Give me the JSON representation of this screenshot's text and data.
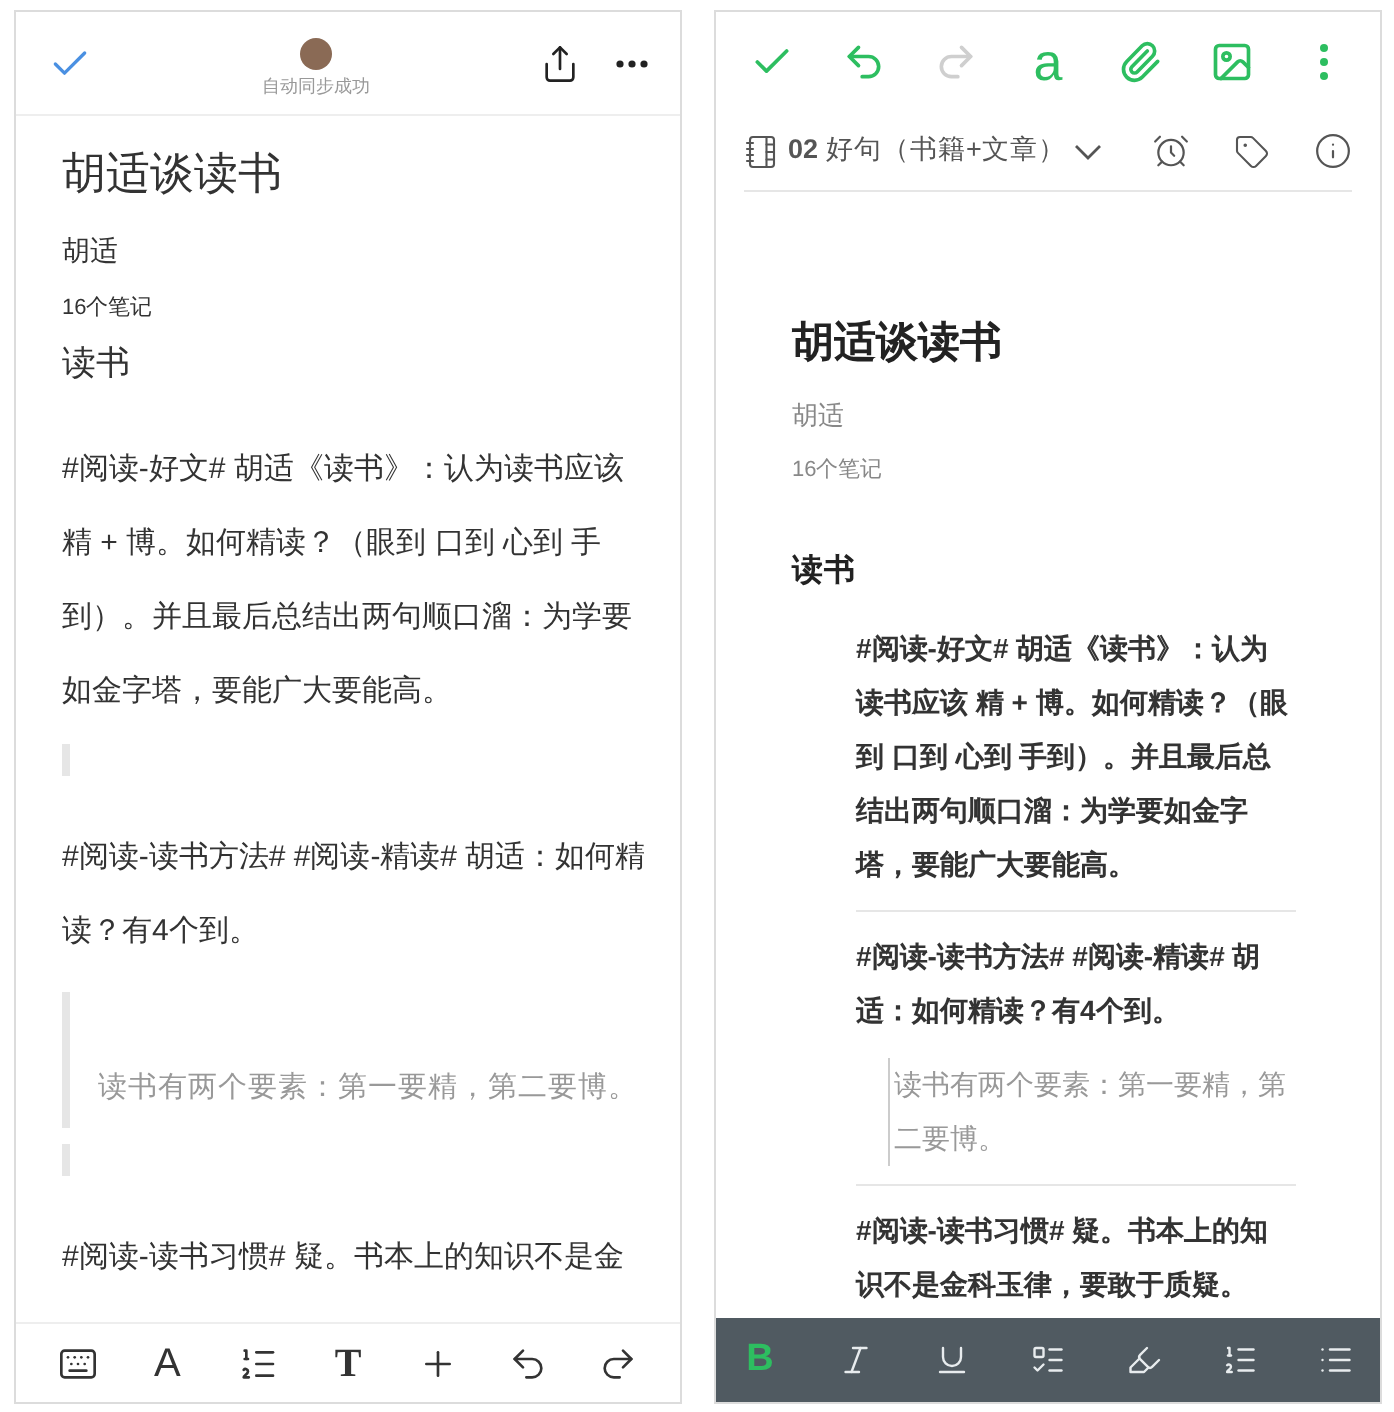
{
  "left_editor": {
    "header": {
      "sync_status": "自动同步成功"
    },
    "title": "胡适谈读书",
    "author": "胡适",
    "note_count": "16个笔记",
    "heading": "读书",
    "blocks": [
      {
        "kind": "paragraph",
        "text": "#阅读-好文# 胡适《读书》：认为读书应该精 + 博。如何精读？（眼到 口到 心到 手到）。并且最后总结出两句顺口溜：为学要如金字塔，要能广大要能高。"
      },
      {
        "kind": "empty_quote"
      },
      {
        "kind": "paragraph",
        "text": "#阅读-读书方法# #阅读-精读# 胡适：如何精读？有4个到。"
      },
      {
        "kind": "quote",
        "text": "读书有两个要素：第一要精，第二要博。"
      },
      {
        "kind": "empty_quote"
      },
      {
        "kind": "paragraph",
        "text": "#阅读-读书习惯# 疑。书本上的知识不是金"
      }
    ],
    "toolbar": [
      {
        "kind": "keyboard"
      },
      {
        "kind": "glyph",
        "label": "A"
      },
      {
        "kind": "ordered_list"
      },
      {
        "kind": "serif_glyph",
        "label": "T"
      },
      {
        "kind": "plus"
      },
      {
        "kind": "undo"
      },
      {
        "kind": "redo"
      }
    ]
  },
  "right_editor": {
    "toolbar": [
      {
        "kind": "check",
        "disabled": false
      },
      {
        "kind": "undo",
        "disabled": false
      },
      {
        "kind": "redo",
        "disabled": true
      },
      {
        "kind": "glyph",
        "label": "a",
        "disabled": false
      },
      {
        "kind": "attach",
        "disabled": false
      },
      {
        "kind": "image",
        "disabled": false
      },
      {
        "kind": "more",
        "disabled": false
      }
    ],
    "notebook": {
      "number": "02",
      "name": "好句（书籍+文章）"
    },
    "title": "胡适谈读书",
    "author": "胡适",
    "note_count": "16个笔记",
    "heading": "读书",
    "notes": [
      {
        "text": "#阅读-好文# 胡适《读书》：认为读书应该 精 + 博。如何精读？（眼到 口到 心到 手到）。并且最后总结出两句顺口溜：为学要如金字塔，要能广大要能高。"
      },
      {
        "text": "#阅读-读书方法# #阅读-精读# 胡适：如何精读？有4个到。",
        "quote": "读书有两个要素：第一要精，第二要博。"
      },
      {
        "text": "#阅读-读书习惯# 疑。书本上的知识不是金科玉律，要敢于质疑。"
      }
    ],
    "format_bar": [
      {
        "kind": "bold",
        "label": "B",
        "selected": true
      },
      {
        "kind": "italic",
        "selected": false
      },
      {
        "kind": "underline",
        "selected": false
      },
      {
        "kind": "checkbox",
        "selected": false
      },
      {
        "kind": "highlight",
        "selected": false
      },
      {
        "kind": "ordered_list",
        "selected": false
      },
      {
        "kind": "bullet_list",
        "selected": false
      }
    ]
  }
}
